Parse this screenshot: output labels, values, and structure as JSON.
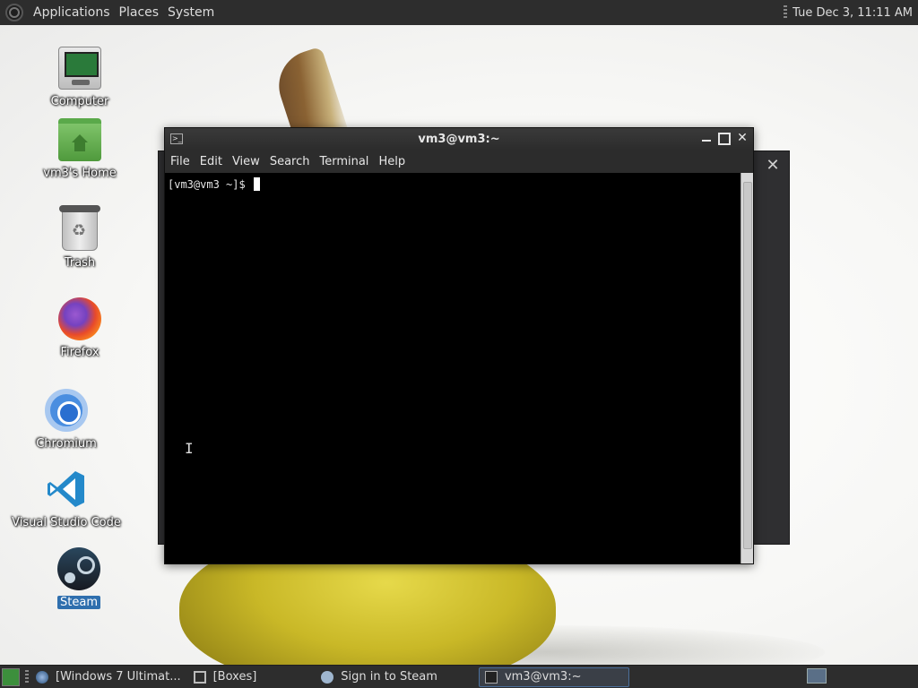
{
  "top_panel": {
    "menus": [
      "Applications",
      "Places",
      "System"
    ],
    "clock": "Tue Dec 3, 11:11 AM"
  },
  "desktop_icons": [
    {
      "label": "Computer",
      "icon": "computer-icon"
    },
    {
      "label": "vm3's Home",
      "icon": "home-folder-icon"
    },
    {
      "label": "Trash",
      "icon": "trash-icon"
    },
    {
      "label": "Firefox",
      "icon": "firefox-icon"
    },
    {
      "label": "Chromium",
      "icon": "chromium-icon"
    },
    {
      "label": "Visual Studio Code",
      "icon": "vscode-icon"
    },
    {
      "label": "Steam",
      "icon": "steam-icon",
      "selected": true
    }
  ],
  "terminal": {
    "title": "vm3@vm3:~",
    "menus": [
      "File",
      "Edit",
      "View",
      "Search",
      "Terminal",
      "Help"
    ],
    "prompt": "[vm3@vm3 ~]$ "
  },
  "taskbar": {
    "tasks": [
      {
        "label": "[Windows 7 Ultimat...",
        "icon": "vm-icon"
      },
      {
        "label": "[Boxes]",
        "icon": "boxes-icon"
      },
      {
        "label": "Sign in to Steam",
        "icon": "steam-icon"
      },
      {
        "label": "vm3@vm3:~",
        "icon": "terminal-icon",
        "active": true
      }
    ]
  },
  "colors": {
    "panel": "#2d2d2d",
    "selection": "#2f6fae",
    "terminal_bg": "#000000"
  }
}
